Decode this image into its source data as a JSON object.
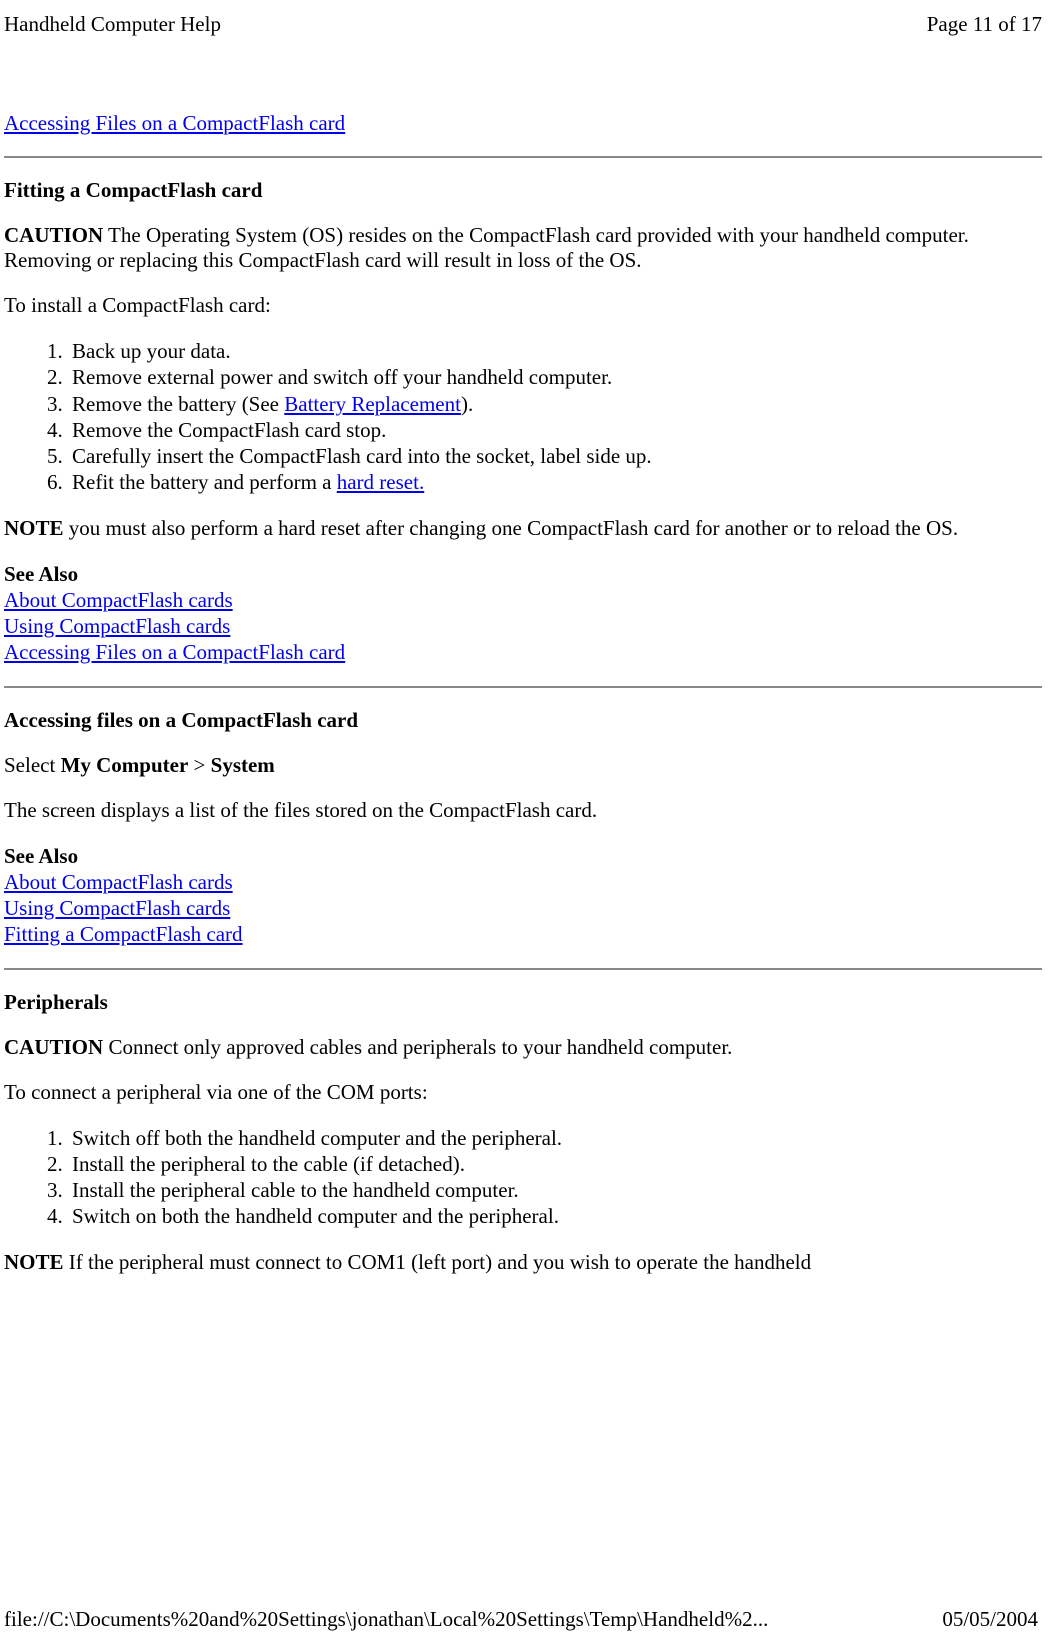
{
  "header": {
    "title": "Handheld Computer Help",
    "page_indicator": "Page 11 of 17"
  },
  "top_link": "Accessing Files on a CompactFlash card",
  "section_fitting": {
    "heading": "Fitting a CompactFlash card",
    "caution_label": "CAUTION",
    "caution_text": "  The Operating System (OS) resides on the CompactFlash card provided with your handheld computer. Removing or replacing this CompactFlash card will result in loss of the OS.",
    "install_intro": "To install a CompactFlash card:",
    "steps": {
      "s1": "Back up your data.",
      "s2": "Remove external power and switch off your handheld computer.",
      "s3_pre": "Remove the battery (See ",
      "s3_link": "Battery Replacement",
      "s3_post": ").",
      "s4": "Remove the CompactFlash card stop.",
      "s5": "Carefully insert the CompactFlash card into the socket, label side up.",
      "s6_pre": "Refit the battery and perform a ",
      "s6_link": "hard reset."
    },
    "note_label": "NOTE",
    "note_text": " you must also perform a hard reset after changing one CompactFlash card for another or to reload the OS.",
    "see_also_label": "See Also",
    "see_also_links": {
      "l1": "About CompactFlash cards",
      "l2": "Using CompactFlash cards",
      "l3": "Accessing Files on a CompactFlash card"
    }
  },
  "section_accessing": {
    "heading": "Accessing files on a CompactFlash card",
    "select_pre": "Select ",
    "select_b1": "My Computer",
    "select_mid": " > ",
    "select_b2": "System",
    "description": "The screen displays a list of the files stored on the CompactFlash card.",
    "see_also_label": "See Also",
    "see_also_links": {
      "l1": "About CompactFlash cards",
      "l2": "Using CompactFlash cards",
      "l3": "Fitting a CompactFlash card"
    }
  },
  "section_peripherals": {
    "heading": "Peripherals",
    "caution_label": "CAUTION",
    "caution_text": " Connect only approved cables and peripherals to your handheld computer.",
    "connect_intro": "To connect a peripheral via one of the COM ports:",
    "steps": {
      "s1": "Switch off both the handheld computer and the peripheral.",
      "s2": "Install the peripheral to the cable (if detached).",
      "s3": "Install the peripheral cable to the handheld computer.",
      "s4": "Switch on both the handheld computer and the peripheral."
    },
    "note_label": "NOTE",
    "note_text": " If the peripheral must connect to COM1 (left port) and you wish to operate the handheld"
  },
  "footer": {
    "path": "file://C:\\Documents%20and%20Settings\\jonathan\\Local%20Settings\\Temp\\Handheld%2...",
    "date": "05/05/2004"
  }
}
